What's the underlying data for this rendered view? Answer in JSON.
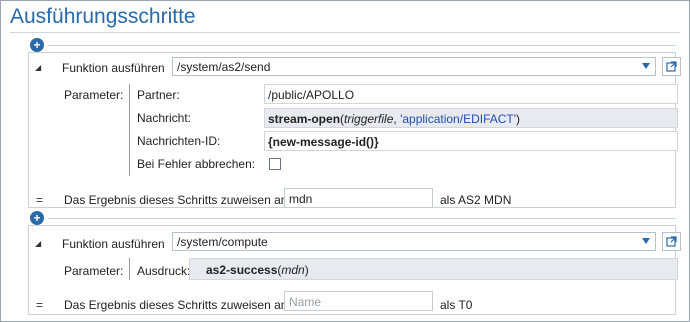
{
  "title": "Ausführungsschritte",
  "steps": [
    {
      "function_label": "Funktion ausführen",
      "function_value": "/system/as2/send",
      "params_label": "Parameter:",
      "params": [
        {
          "label": "Partner:",
          "value": "/public/APOLLO"
        },
        {
          "label": "Nachricht:",
          "fn": "stream-open",
          "open": "(",
          "arg1": "triggerfile",
          "comma": ", ",
          "arg2": "'application/EDIFACT'",
          "close": ")"
        },
        {
          "label": "Nachrichten-ID:",
          "value": "{new-message-id()}"
        },
        {
          "label": "Bei Fehler abbrechen:",
          "checked": false
        }
      ],
      "result_eq": "=",
      "result_label": "Das Ergebnis dieses Schritts zuweisen an",
      "result_value": "mdn",
      "result_suffix": "als AS2 MDN"
    },
    {
      "function_label": "Funktion ausführen",
      "function_value": "/system/compute",
      "params_label": "Parameter:",
      "params": [
        {
          "label": "Ausdruck:",
          "fn": "as2-success",
          "open": "(",
          "arg1": "mdn",
          "close": ")"
        }
      ],
      "result_eq": "=",
      "result_label": "Das Ergebnis dieses Schritts zuweisen an",
      "result_placeholder": "Name",
      "result_suffix": "als T0"
    }
  ],
  "icons": {
    "add": "plus-icon",
    "collapse": "collapse-triangle-icon",
    "dropdown": "chevron-down-icon",
    "open_external": "open-external-icon"
  },
  "colors": {
    "accent": "#2a6aa8",
    "string": "#1c4db5",
    "expression_bg": "#e9eaf0"
  }
}
